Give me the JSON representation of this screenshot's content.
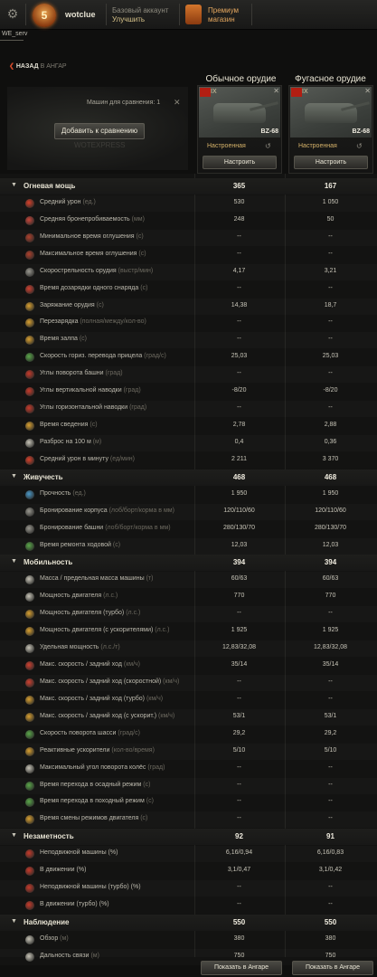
{
  "header": {
    "nickname": "wotclue",
    "account_line1": "Базовый аккаунт",
    "account_line2": "Улучшить",
    "premium_line1": "Премиум",
    "premium_line2": "магазин",
    "server": "WE_serv"
  },
  "nav": {
    "back_label": "НАЗАД",
    "back_target": "В АНГАР"
  },
  "compare": {
    "count_label": "Машин для сравнения: 1",
    "add_button": "Добавить к сравнению",
    "watermark": "WOTEXPRESS"
  },
  "columns": [
    {
      "title": "Обычное орудие",
      "tier": "IX",
      "tank": "BZ-68",
      "config": "Настроенная",
      "configure_button": "Настроить",
      "hangar_button": "Показать в Ангаре"
    },
    {
      "title": "Фугасное орудие",
      "tier": "IX",
      "tank": "BZ-68",
      "config": "Настроенная",
      "configure_button": "Настроить",
      "hangar_button": "Показать в Ангаре"
    }
  ],
  "rows": [
    {
      "section": true,
      "label": "Огневая мощь",
      "v1": "365",
      "v2": "167"
    },
    {
      "label": "Средний урон",
      "unit": "(ед.)",
      "v1": "530",
      "v2": "1 050",
      "icon": "#d8402a"
    },
    {
      "label": "Средняя бронепробиваемость",
      "unit": "(мм)",
      "v1": "248",
      "v2": "50",
      "icon": "#c8463a"
    },
    {
      "label": "Минимальное время оглушения",
      "unit": "(с)",
      "v1": "--",
      "v2": "--",
      "icon": "#b0402c"
    },
    {
      "label": "Максимальное время оглушения",
      "unit": "(с)",
      "v1": "--",
      "v2": "--",
      "icon": "#b0402c"
    },
    {
      "label": "Скорострельность орудия",
      "unit": "(выстр/мин)",
      "v1": "4,17",
      "v2": "3,21",
      "icon": "#9a9890"
    },
    {
      "label": "Время дозарядки одного снаряда",
      "unit": "(с)",
      "v1": "--",
      "v2": "--",
      "icon": "#d04030"
    },
    {
      "label": "Заряжание орудия",
      "unit": "(с)",
      "v1": "14,38",
      "v2": "18,7",
      "icon": "#d9a030"
    },
    {
      "label": "Перезарядка",
      "unit": "(полная/между/кол-во)",
      "v1": "--",
      "v2": "--",
      "icon": "#d9a030"
    },
    {
      "label": "Время залпа",
      "unit": "(с)",
      "v1": "--",
      "v2": "--",
      "icon": "#d9a030"
    },
    {
      "label": "Скорость гориз. перевода прицела",
      "unit": "(град/с)",
      "v1": "25,03",
      "v2": "25,03",
      "icon": "#5aa84a"
    },
    {
      "label": "Углы поворота башни",
      "unit": "(град)",
      "v1": "--",
      "v2": "--",
      "icon": "#c83a2a"
    },
    {
      "label": "Углы вертикальной наводки",
      "unit": "(град)",
      "v1": "-8/20",
      "v2": "-8/20",
      "icon": "#c83a2a"
    },
    {
      "label": "Углы горизонтальной наводки",
      "unit": "(град)",
      "v1": "--",
      "v2": "--",
      "icon": "#c83a2a"
    },
    {
      "label": "Время сведения",
      "unit": "(с)",
      "v1": "2,78",
      "v2": "2,88",
      "icon": "#d9a030"
    },
    {
      "label": "Разброс на 100 м",
      "unit": "(м)",
      "v1": "0,4",
      "v2": "0,36",
      "icon": "#c8c5b8"
    },
    {
      "label": "Средний урон в минуту",
      "unit": "(ед/мин)",
      "v1": "2 211",
      "v2": "3 370",
      "icon": "#d8402a"
    },
    {
      "section": true,
      "label": "Живучесть",
      "v1": "468",
      "v2": "468"
    },
    {
      "label": "Прочность",
      "unit": "(ед.)",
      "v1": "1 950",
      "v2": "1 950",
      "icon": "#4a98c8"
    },
    {
      "label": "Бронирование корпуса",
      "unit": "(лоб/борт/корма в мм)",
      "v1": "120/110/60",
      "v2": "120/110/60",
      "icon": "#9a9890"
    },
    {
      "label": "Бронирование башни",
      "unit": "(лоб/борт/корма в мм)",
      "v1": "280/130/70",
      "v2": "280/130/70",
      "icon": "#9a9890"
    },
    {
      "label": "Время ремонта ходовой",
      "unit": "(с)",
      "v1": "12,03",
      "v2": "12,03",
      "icon": "#5aa84a"
    },
    {
      "section": true,
      "label": "Мобильность",
      "v1": "394",
      "v2": "394"
    },
    {
      "label": "Масса / предельная масса машины",
      "unit": "(т)",
      "v1": "60/63",
      "v2": "60/63",
      "icon": "#c8c5b8"
    },
    {
      "label": "Мощность двигателя",
      "unit": "(л.с.)",
      "v1": "770",
      "v2": "770",
      "icon": "#c8c5b8"
    },
    {
      "label": "Мощность двигателя (турбо)",
      "unit": "(л.с.)",
      "v1": "--",
      "v2": "--",
      "icon": "#d9a030"
    },
    {
      "label": "Мощность двигателя (с ускорителями)",
      "unit": "(л.с.)",
      "v1": "1 925",
      "v2": "1 925",
      "icon": "#d9a030"
    },
    {
      "label": "Удельная мощность",
      "unit": "(л.с./т)",
      "v1": "12,83/32,08",
      "v2": "12,83/32,08",
      "icon": "#c8c5b8"
    },
    {
      "label": "Макс. скорость / задний ход",
      "unit": "(км/ч)",
      "v1": "35/14",
      "v2": "35/14",
      "icon": "#d04030"
    },
    {
      "label": "Макс. скорость / задний ход (скоростной)",
      "unit": "(км/ч)",
      "v1": "--",
      "v2": "--",
      "icon": "#d04030"
    },
    {
      "label": "Макс. скорость / задний ход (турбо)",
      "unit": "(км/ч)",
      "v1": "--",
      "v2": "--",
      "icon": "#d9a030"
    },
    {
      "label": "Макс. скорость / задний ход (с ускорит.)",
      "unit": "(км/ч)",
      "v1": "53/1",
      "v2": "53/1",
      "icon": "#d9a030"
    },
    {
      "label": "Скорость поворота шасси",
      "unit": "(град/с)",
      "v1": "29,2",
      "v2": "29,2",
      "icon": "#5aa84a"
    },
    {
      "label": "Реактивные ускорители",
      "unit": "(кол-во/время)",
      "v1": "5/10",
      "v2": "5/10",
      "icon": "#d9a030"
    },
    {
      "label": "Максимальный угол поворота колёс",
      "unit": "(град)",
      "v1": "--",
      "v2": "--",
      "icon": "#c8c5b8"
    },
    {
      "label": "Время перехода в осадный режим",
      "unit": "(с)",
      "v1": "--",
      "v2": "--",
      "icon": "#5aa84a"
    },
    {
      "label": "Время перехода в походный режим",
      "unit": "(с)",
      "v1": "--",
      "v2": "--",
      "icon": "#5aa84a"
    },
    {
      "label": "Время смены режимов двигателя",
      "unit": "(с)",
      "v1": "--",
      "v2": "--",
      "icon": "#d9a030"
    },
    {
      "section": true,
      "label": "Незаметность",
      "v1": "92",
      "v2": "91"
    },
    {
      "label": "Неподвижной машины (%)",
      "unit": "",
      "v1": "6,16/0,94",
      "v2": "6,16/0,83",
      "icon": "#c83a2a"
    },
    {
      "label": "В движении (%)",
      "unit": "",
      "v1": "3,1/0,47",
      "v2": "3,1/0,42",
      "icon": "#c83a2a"
    },
    {
      "label": "Неподвижной машины (турбо) (%)",
      "unit": "",
      "v1": "--",
      "v2": "--",
      "icon": "#c83a2a"
    },
    {
      "label": "В движении (турбо) (%)",
      "unit": "",
      "v1": "--",
      "v2": "--",
      "icon": "#c83a2a"
    },
    {
      "section": true,
      "label": "Наблюдение",
      "v1": "550",
      "v2": "550"
    },
    {
      "label": "Обзор",
      "unit": "(м)",
      "v1": "380",
      "v2": "380",
      "icon": "#c8c5b8"
    },
    {
      "label": "Дальность связи",
      "unit": "(м)",
      "v1": "750",
      "v2": "750",
      "icon": "#c8c5b8"
    }
  ]
}
